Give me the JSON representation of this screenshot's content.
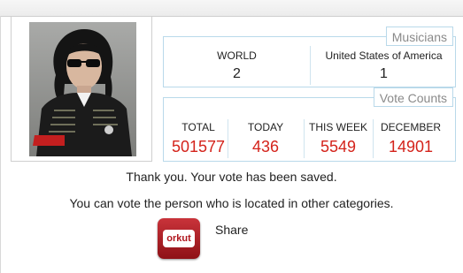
{
  "colors": {
    "panel_border": "#b9d9ea",
    "count_red": "#d4231b",
    "orkut_red": "#b0151c"
  },
  "photo": {
    "icon": "portrait-photo"
  },
  "musicians": {
    "title": "Musicians",
    "columns": [
      {
        "label": "WORLD",
        "value": "2"
      },
      {
        "label": "United States of America",
        "value": "1"
      }
    ]
  },
  "vote_counts": {
    "title": "Vote Counts",
    "columns": [
      {
        "label": "TOTAL",
        "value": "501577"
      },
      {
        "label": "TODAY",
        "value": "436"
      },
      {
        "label": "THIS WEEK",
        "value": "5549"
      },
      {
        "label": "DECEMBER",
        "value": "14901"
      }
    ]
  },
  "messages": {
    "saved": "Thank you. Your vote has been saved.",
    "other_categories": "You can vote the person who is located in other categories."
  },
  "share": {
    "icon": "orkut-icon",
    "logo_text": "orkut",
    "label": "Share"
  }
}
